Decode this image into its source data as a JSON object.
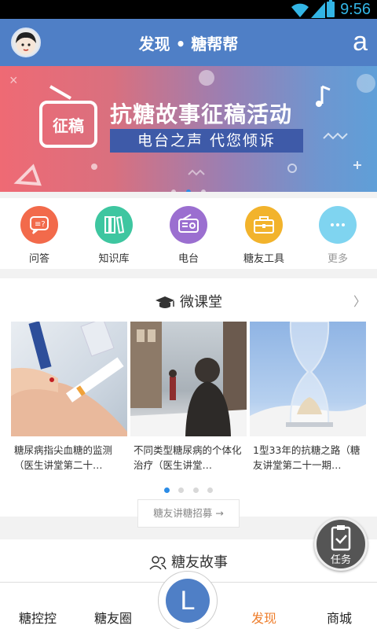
{
  "status_bar": {
    "time": "9:56"
  },
  "header": {
    "title": "发现 • 糖帮帮",
    "right_label": "a"
  },
  "banner": {
    "badge": "征稿",
    "headline": "抗糖故事征稿活动",
    "subtitle": "电台之声  代您倾诉",
    "page_index": 2,
    "page_count": 3
  },
  "quick_nav": {
    "items": [
      {
        "label": "问答",
        "icon": "qa-icon",
        "color": "#f26a4b"
      },
      {
        "label": "知识库",
        "icon": "books-icon",
        "color": "#3ec6a0"
      },
      {
        "label": "电台",
        "icon": "radio-icon",
        "color": "#9b6fd0"
      },
      {
        "label": "糖友工具",
        "icon": "toolbox-icon",
        "color": "#f2b32c"
      },
      {
        "label": "更多",
        "icon": "more-icon",
        "color": "#7fd4f0"
      }
    ]
  },
  "micro_class": {
    "title": "微课堂",
    "cards": [
      {
        "caption": "糖尿病指尖血糖的监测（医生讲堂第二十…"
      },
      {
        "caption": "不同类型糖尿病的个体化治疗（医生讲堂…"
      },
      {
        "caption": "1型33年的抗糖之路（糖友讲堂第二十一期…"
      }
    ],
    "page_index": 1,
    "page_count": 4,
    "recruit_button": "糖友讲糖招募 →"
  },
  "stories": {
    "title": "糖友故事"
  },
  "task_button": {
    "label": "任务"
  },
  "tab_bar": {
    "tabs": [
      "糖控控",
      "糖友圈",
      "发现",
      "商城"
    ],
    "active": "发现",
    "center_label": "L",
    "accent": "#ee7d2b"
  },
  "colors": {
    "brand": "#4f7fc6",
    "indicator": "#2b8ce6"
  }
}
